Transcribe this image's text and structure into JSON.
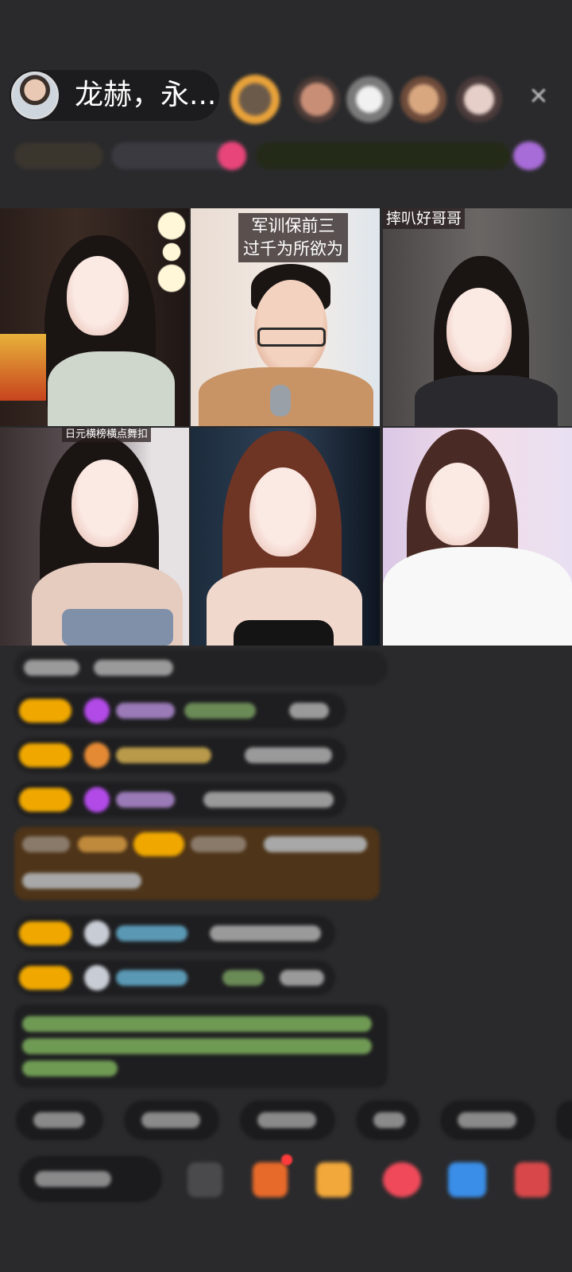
{
  "host": {
    "name": "龙赫，永..."
  },
  "top_bar": {
    "close_icon": "close-icon"
  },
  "video_tiles": [
    {
      "label": ""
    },
    {
      "label_line1": "军训保前三",
      "label_line2": "过千为所欲为"
    },
    {
      "label": "摔叭好哥哥"
    },
    {
      "label": "日元横榜横点舞扣"
    },
    {
      "label": ""
    },
    {
      "label": ""
    }
  ],
  "colors": {
    "background": "#2a2a2c",
    "badge_gold": "#f0a800",
    "chat_bubble": "#1e1e20",
    "highlight_row": "#5a3a18"
  }
}
